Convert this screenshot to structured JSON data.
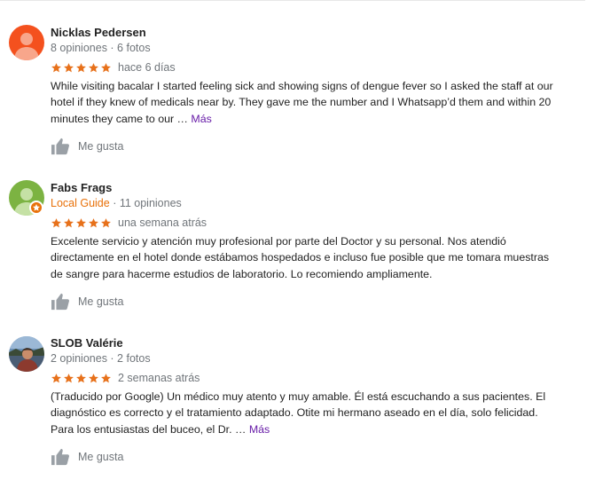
{
  "reviews": [
    {
      "name": "Nicklas Pedersen",
      "meta": "8 opiniones · 6 fotos",
      "local_guide": false,
      "rating": 5,
      "date": "hace 6 días",
      "text_lines": [
        "While visiting bacalar I started feeling sick and showing signs of dengue fever so I asked the staff at our",
        "hotel if they knew of medicals near by. They gave me the number and I Whatsapp’d them and within 20",
        "minutes they came to our … "
      ],
      "more_label": "Más",
      "like_label": "Me gusta",
      "avatar_color": "#f4511e"
    },
    {
      "name": "Fabs Frags",
      "meta_guide": "Local Guide",
      "meta": " · 11 opiniones",
      "local_guide": true,
      "rating": 5,
      "date": "una semana atrás",
      "text_lines": [
        "Excelente servicio y atención muy profesional por parte del Doctor y su personal. Nos atendió",
        "directamente en el hotel donde estábamos hospedados e incluso fue posible que me tomara muestras",
        "de sangre para hacerme estudios de laboratorio. Lo recomiendo ampliamente."
      ],
      "like_label": "Me gusta",
      "avatar_color": "#7cb342"
    },
    {
      "name": "SLOB Valérie",
      "meta": "2 opiniones · 2 fotos",
      "local_guide": false,
      "rating": 5,
      "date": "2 semanas atrás",
      "text_lines": [
        "(Traducido por Google) Un médico muy atento y muy amable. Él está escuchando a sus pacientes. El",
        "diagnóstico es correcto y el tratamiento adaptado. Otite mi hermano aseado en el día, solo felicidad.",
        "Para los entusiastas del buceo, el Dr. … "
      ],
      "more_label": "Más",
      "like_label": "Me gusta",
      "avatar_kind": "photo"
    }
  ],
  "colors": {
    "star": "#e7711b",
    "guide": "#e8710a",
    "link": "#681da8",
    "muted": "#70757a"
  }
}
